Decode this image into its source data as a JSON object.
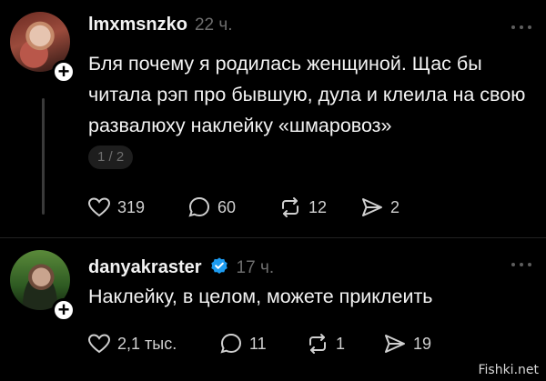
{
  "posts": [
    {
      "username": "lmxmsnzko",
      "time": "22 ч.",
      "text": "Бля почему я родилась женщиной. Щас бы читала рэп про бывшую, дула и клеила на свою развалюху наклейку «шмаровоз»",
      "page_indicator": "1 / 2",
      "likes": "319",
      "comments": "60",
      "reposts": "12",
      "shares": "2",
      "verified": false
    },
    {
      "username": "danyakraster",
      "time": "17 ч.",
      "text": "Наклейку, в целом, можете приклеить",
      "likes": "2,1 тыс.",
      "comments": "11",
      "reposts": "1",
      "shares": "19",
      "verified": true
    }
  ],
  "follow_symbol": "+",
  "watermark": "Fishki.net",
  "icons": {
    "like": "heart-icon",
    "comment": "speech-bubble-icon",
    "repost": "repost-arrows-icon",
    "share": "paper-plane-icon",
    "more": "ellipsis-icon",
    "verified": "verified-badge-icon"
  },
  "colors": {
    "background": "#000000",
    "text": "#f3f3f3",
    "muted": "#6e6e6e",
    "verified": "#1d9bf0"
  }
}
